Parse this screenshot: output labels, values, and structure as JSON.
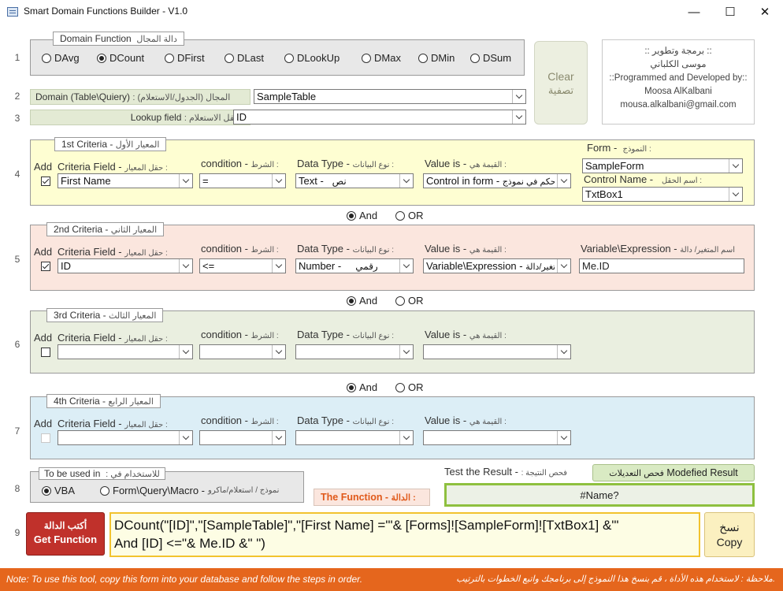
{
  "window": {
    "title": "Smart Domain Functions Builder -  V1.0",
    "minimize": "—",
    "maximize": "☐",
    "close": "✕"
  },
  "row_numbers": [
    "1",
    "2",
    "3",
    "4",
    "5",
    "6",
    "7",
    "8",
    "9"
  ],
  "domain_function": {
    "legend_en": "Domain Function",
    "legend_ar": "دالة المجال",
    "options": [
      "DAvg",
      "DCount",
      "DFirst",
      "DLast",
      "DLookUp",
      "DMax",
      "DMin",
      "DSum"
    ],
    "selected": "DCount"
  },
  "clear_button": {
    "en": "Clear",
    "ar": "تصفية"
  },
  "credits": {
    "line1": ":: برمجة وتطوير ::",
    "line2": "موسى الكلباني",
    "line3": "::Programmed and Developed by::",
    "line4": "Moosa AlKalbani",
    "line5": "mousa.alkalbani@gmail.com"
  },
  "domain": {
    "label_en": "Domain (Table\\Quiery)",
    "label_ar": ": المجال (الجدول/الاستعلام)",
    "value": "SampleTable"
  },
  "lookup": {
    "label_en": "Lookup field",
    "label_ar": ": حقل الاستعلام  -",
    "value": "ID"
  },
  "headers": {
    "add": "Add",
    "criteria_field_en": "Criteria Field -",
    "criteria_field_ar": "حقل المعيار :",
    "condition_en": "condition -",
    "condition_ar": "الشرط :",
    "data_type_en": "Data Type -",
    "data_type_ar": "نوع البيانات :",
    "value_is_en": "Value is -",
    "value_is_ar": "القيمة هي :"
  },
  "criteria": [
    {
      "legend_en": "1st Criteria -",
      "legend_ar": "المعيار الأول",
      "checked": true,
      "field": "First Name",
      "condition": "=",
      "data_type_en": "Text -",
      "data_type_ar": "نص",
      "value_is_en": "Control in form -",
      "value_is_ar": "حكم في نموذج",
      "bg": "#fefed2"
    },
    {
      "legend_en": "2nd Criteria -",
      "legend_ar": "المعيار الثاني",
      "checked": true,
      "field": "ID",
      "condition": "<=",
      "data_type_en": "Number -",
      "data_type_ar": "رقمي",
      "value_is_en": "Variable\\Expression -",
      "value_is_ar": "تغير/دالة",
      "bg": "#fbe6de"
    },
    {
      "legend_en": "3rd Criteria -",
      "legend_ar": "المعيار الثالث",
      "checked": false,
      "field": "",
      "condition": "",
      "data_type_en": "",
      "data_type_ar": "",
      "value_is_en": "",
      "value_is_ar": "",
      "bg": "#eaefe0"
    },
    {
      "legend_en": "4th Criteria -",
      "legend_ar": "المعيار الرابع",
      "checked": false,
      "field": "",
      "condition": "",
      "data_type_en": "",
      "data_type_ar": "",
      "value_is_en": "",
      "value_is_ar": "",
      "bg": "#dceef6"
    }
  ],
  "form_panel": {
    "form_en": "Form -",
    "form_ar": "النموذج :",
    "form_value": "SampleForm",
    "control_en": "Control Name -",
    "control_ar": "اسم الحقل :",
    "control_value": "TxtBox1"
  },
  "variable_panel": {
    "label_en": "Variable\\Expression -",
    "label_ar": "اسم المتغير/ دالة",
    "value": "Me.ID"
  },
  "and_or": {
    "and": "And",
    "or": "OR"
  },
  "to_be_used": {
    "legend_en": "To be used in",
    "legend_ar": ": للاستخدام في",
    "vba": "VBA",
    "form_en": "Form\\Query\\Macro -",
    "form_ar": "نموذج / استعلام/ماكرو"
  },
  "the_function": {
    "en": "The Function -",
    "ar": "الدالة :"
  },
  "test_result": {
    "label_en": "Test the Result -",
    "label_ar": ": فحص النتيجة",
    "button_ar": "فحص التعديلات",
    "button_en": "Modefied Result",
    "value": "#Name?"
  },
  "get_function": {
    "ar": "أكتب الدالة",
    "en": "Get Function"
  },
  "function_text": {
    "line1": "DCount(\"[ID]\",\"[SampleTable]\",\"[First Name] ='\"& [Forms]![SampleForm]![TxtBox1] &\"'",
    "line2": "And [ID] <=\"& Me.ID &\" \")"
  },
  "copy_button": {
    "ar": "نسخ",
    "en": "Copy"
  },
  "footer": {
    "en": "Note: To use this tool, copy this form into your database and follow the steps in order.",
    "ar": "ملاحظة : لاستخدام هذه الأداة ، قم بنسخ هذا النموذج إلى برنامجك واتبع الخطوات بالترتيب."
  }
}
